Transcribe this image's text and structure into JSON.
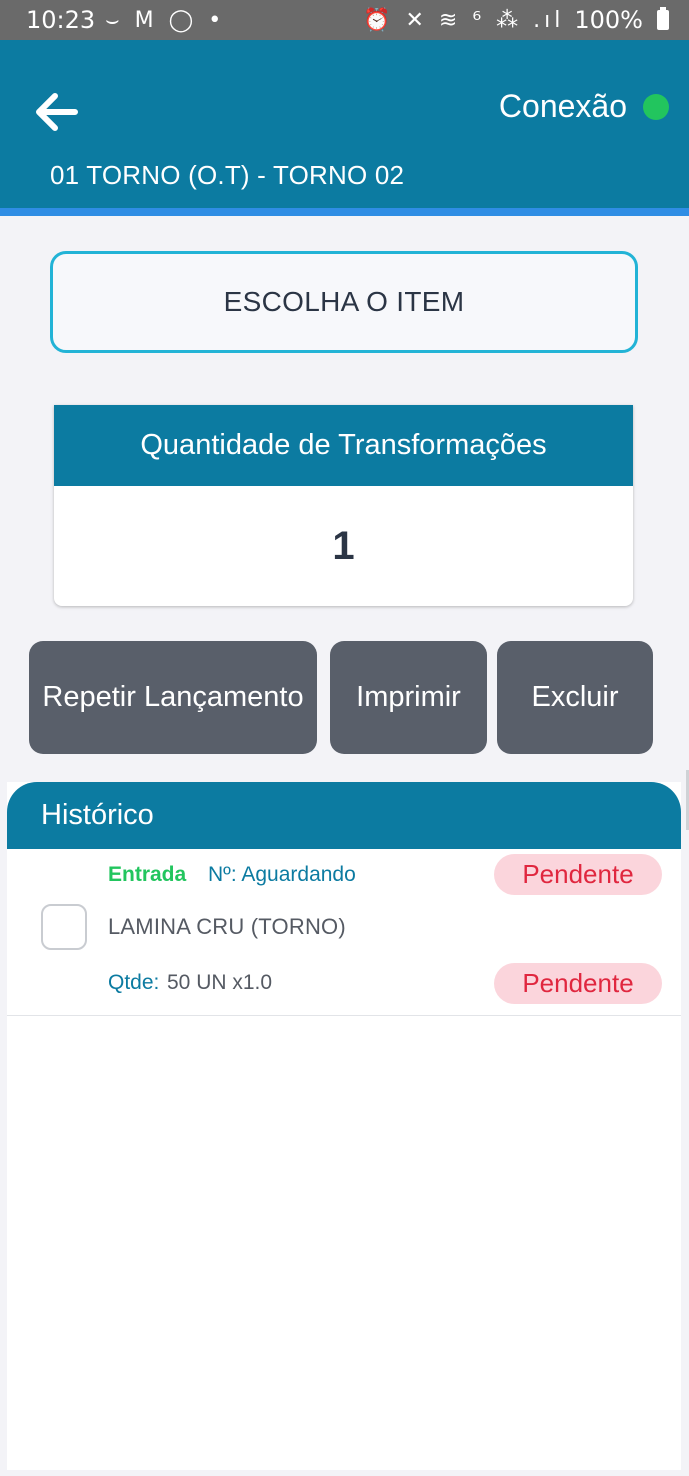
{
  "status_bar": {
    "time": "10:23",
    "left_icons": "⌣ M ◯ •",
    "right_icons": "⏰ ✕ ≋ ⁶ ⁂ .ıl",
    "battery": "100%"
  },
  "header": {
    "back_icon": "arrow-left-icon",
    "connection_label": "Conexão",
    "connection_status_color": "#22c55e",
    "subtitle": "01 TORNO (O.T) - TORNO 02"
  },
  "item_selector": {
    "label": "ESCOLHA O ITEM"
  },
  "transformations": {
    "title": "Quantidade de Transformações",
    "value": "1"
  },
  "actions": {
    "repeat": "Repetir Lançamento",
    "print": "Imprimir",
    "delete": "Excluir"
  },
  "history": {
    "title": "Histórico",
    "items": [
      {
        "type": "Entrada",
        "number": "Nº: Aguardando",
        "name": "LAMINA CRU (TORNO)",
        "qty_label": "Qtde:",
        "qty_value": "50 UN x1.0",
        "status_1": "Pendente",
        "status_2": "Pendente"
      }
    ]
  },
  "colors": {
    "primary": "#0c7ba1",
    "accent_border": "#22b3d6",
    "button": "#595f6a",
    "entrada": "#22c55e",
    "pending_bg": "#fbd5dc",
    "pending_text": "#e0273f"
  }
}
